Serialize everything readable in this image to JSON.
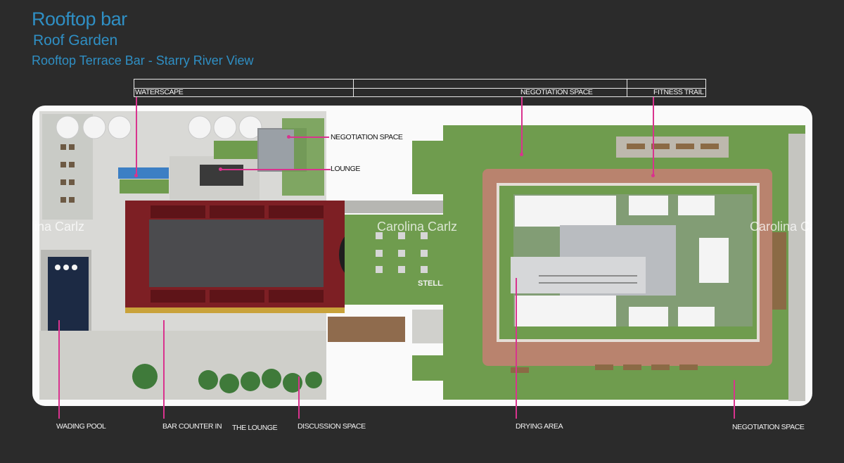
{
  "title": "Rooftop bar",
  "subtitle": "Roof Garden",
  "subtitle2": "Rooftop Terrace Bar - Starry River View",
  "header_labels": {
    "waterscape": "WATERSCAPE",
    "negotiation": "NEGOTIATION SPACE",
    "fitness": "FITNESS TRAIL"
  },
  "callouts": {
    "negotiation_left": "NEGOTIATION SPACE",
    "lounge": "LOUNGE"
  },
  "bottom_labels": {
    "wading_pool": "WADING POOL",
    "bar_counter": "BAR COUNTER IN",
    "the_lounge": "THE LOUNGE",
    "discussion": "DISCUSSION SPACE",
    "drying": "DRYING AREA",
    "negotiation_right": "NEGOTIATION SPACE"
  },
  "watermark": "Carolina Carlz",
  "lawn_sign": "STELLAR BAY",
  "colors": {
    "title": "#2f8fc4",
    "leader": "#d9338e",
    "lawn": "#6f9c4e",
    "track": "#b9836e",
    "roof": "#7d1f24",
    "pool": "#1c2a44"
  }
}
